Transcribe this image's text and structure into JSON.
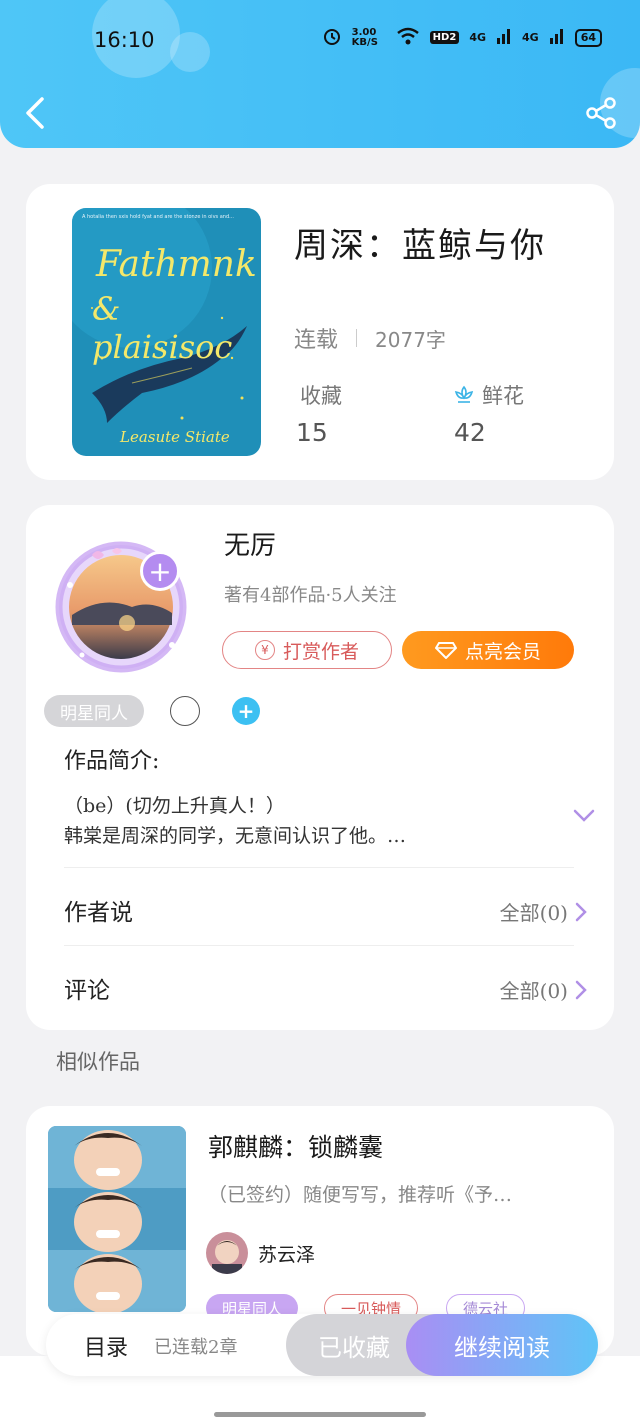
{
  "status_bar": {
    "time": "16:10",
    "speed": "3.00 KB/S",
    "network1": "4G",
    "network2": "4G",
    "battery": "64"
  },
  "book": {
    "cover_text_top": "A hotalia then sxis hold fyat and are the stonze in oivs and...",
    "cover_title_line1": "Fathmnk",
    "cover_title_line2": "& plaisisoc",
    "cover_author": "Leasute Stiate",
    "title": "周深：蓝鲸与你",
    "status": "连载",
    "word_count": "2077字",
    "favorites_label": "收藏",
    "favorites_value": "15",
    "flowers_label": "鲜花",
    "flowers_value": "42"
  },
  "author": {
    "name": "无厉",
    "info": "著有4部作品·5人关注",
    "tip_label": "打赏作者",
    "tip_icon": "¥",
    "vip_label": "点亮会员",
    "tag": "明星同人"
  },
  "intro": {
    "heading": "作品简介:",
    "line1": "（be）(切勿上升真人！）",
    "line2": "韩棠是周深的同学，无意间认识了他。…"
  },
  "author_says": {
    "label": "作者说",
    "right": "全部(0)"
  },
  "comments": {
    "label": "评论",
    "right": "全部(0)"
  },
  "similar": {
    "heading": "相似作品",
    "title": "郭麒麟：锁麟囊",
    "desc": "（已签约）随便写写，推荐听《予…",
    "author": "苏云泽",
    "tags": [
      "明星同人",
      "一见钟情",
      "德云社"
    ]
  },
  "bottom_bar": {
    "toc_label": "目录",
    "toc_sub": "已连载2章",
    "collected_label": "已收藏",
    "continue_label": "继续阅读"
  },
  "colors": {
    "header": "#3bb8f5",
    "accent_orange": "#ff8a14",
    "accent_blue": "#3cc0f2",
    "tip_red": "#d85b5b"
  }
}
